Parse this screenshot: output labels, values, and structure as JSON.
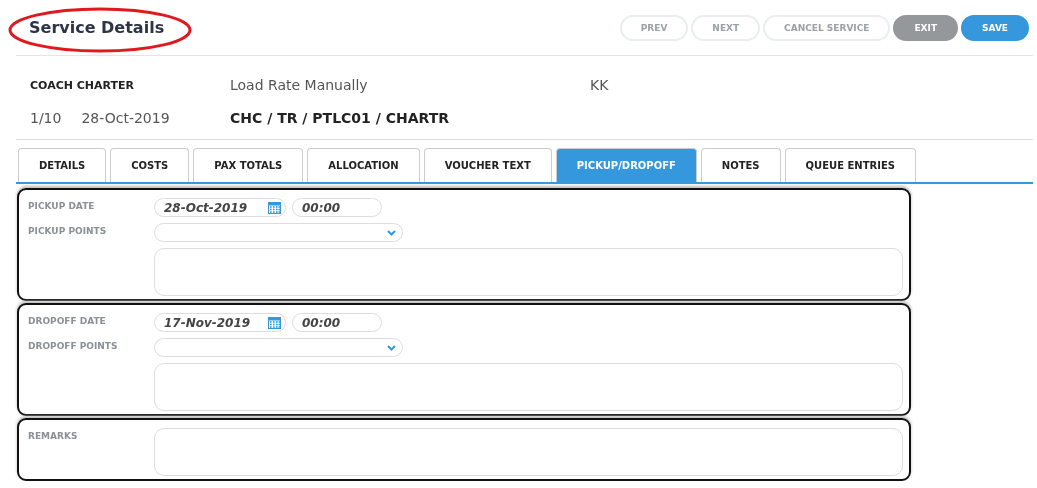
{
  "title": "Service Details",
  "buttons": [
    {
      "label": "PREV",
      "kind": "outline"
    },
    {
      "label": "NEXT",
      "kind": "outline"
    },
    {
      "label": "CANCEL SERVICE",
      "kind": "outline"
    },
    {
      "label": "EXIT",
      "kind": "gray"
    },
    {
      "label": "SAVE",
      "kind": "primary"
    }
  ],
  "info": {
    "service_type": "COACH CHARTER",
    "rate_mode": "Load Rate Manually",
    "code": "KK",
    "sequence": "1/10",
    "date": "28-Oct-2019",
    "path": "CHC / TR / PTLC01 / CHARTR"
  },
  "tabs": [
    {
      "label": "DETAILS",
      "selected": false
    },
    {
      "label": "COSTS",
      "selected": false
    },
    {
      "label": "PAX TOTALS",
      "selected": false
    },
    {
      "label": "ALLOCATION",
      "selected": false
    },
    {
      "label": "VOUCHER TEXT",
      "selected": false
    },
    {
      "label": "PICKUP/DROPOFF",
      "selected": true
    },
    {
      "label": "NOTES",
      "selected": false
    },
    {
      "label": "QUEUE ENTRIES",
      "selected": false
    }
  ],
  "sections": [
    {
      "kind": "date_points",
      "date_label": "PICKUP DATE",
      "date": "28-Oct-2019",
      "time": "00:00",
      "points_label": "PICKUP POINTS"
    },
    {
      "kind": "date_points",
      "date_label": "DROPOFF DATE",
      "date": "17-Nov-2019",
      "time": "00:00",
      "points_label": "DROPOFF POINTS"
    },
    {
      "kind": "remarks",
      "label": "REMARKS"
    }
  ]
}
